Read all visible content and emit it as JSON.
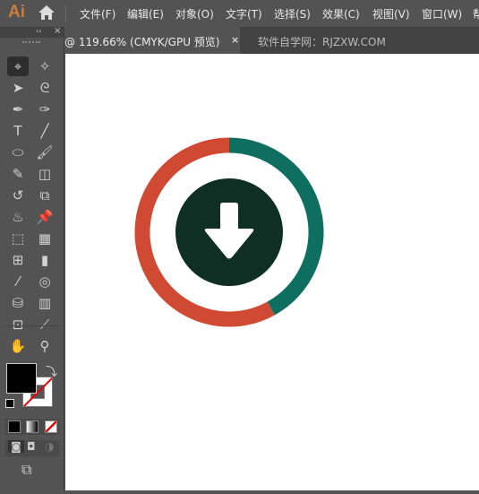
{
  "app": {
    "logo": "Ai"
  },
  "menu": [
    "文件(F)",
    "编辑(E)",
    "对象(O)",
    "文字(T)",
    "选择(S)",
    "效果(C)",
    "视图(V)",
    "窗口(W)",
    "帮"
  ],
  "tabs": {
    "active": "@ 119.66% (CMYK/GPU 预览)",
    "close": "×",
    "other": "软件自学网：RJZXW.COM"
  },
  "panel": {
    "collapse": "‹‹",
    "close": "×"
  },
  "tools": [
    {
      "name": "selection",
      "glyph": "⌖"
    },
    {
      "name": "magic-wand",
      "glyph": "✧"
    },
    {
      "name": "direct-selection",
      "glyph": "➤"
    },
    {
      "name": "lasso",
      "glyph": "ᘓ"
    },
    {
      "name": "pen",
      "glyph": "✒"
    },
    {
      "name": "curvature",
      "glyph": "✑"
    },
    {
      "name": "type",
      "glyph": "T"
    },
    {
      "name": "line",
      "glyph": "╱"
    },
    {
      "name": "ellipse",
      "glyph": "⬭"
    },
    {
      "name": "paintbrush",
      "glyph": "🖌"
    },
    {
      "name": "shaper",
      "glyph": "✎"
    },
    {
      "name": "eraser",
      "glyph": "◫"
    },
    {
      "name": "rotate",
      "glyph": "↺"
    },
    {
      "name": "scale",
      "glyph": "⧉"
    },
    {
      "name": "warp",
      "glyph": "♨"
    },
    {
      "name": "puppet-warp",
      "glyph": "📌"
    },
    {
      "name": "free-transform",
      "glyph": "⬚"
    },
    {
      "name": "perspective-grid",
      "glyph": "▦"
    },
    {
      "name": "mesh",
      "glyph": "⊞"
    },
    {
      "name": "gradient",
      "glyph": "▮"
    },
    {
      "name": "eyedropper",
      "glyph": "⁄"
    },
    {
      "name": "blend",
      "glyph": "◎"
    },
    {
      "name": "symbol-sprayer",
      "glyph": "⛁"
    },
    {
      "name": "column-graph",
      "glyph": "▥"
    },
    {
      "name": "artboard",
      "glyph": "⊡"
    },
    {
      "name": "slice",
      "glyph": "⟋"
    },
    {
      "name": "hand",
      "glyph": "✋"
    },
    {
      "name": "zoom",
      "glyph": "⚲"
    }
  ],
  "colors": {
    "fill": "#000000",
    "stroke": "none",
    "ring_teal": "#0e6e60",
    "ring_red": "#d04a33",
    "inner": "#0f2e24",
    "canvas": "#ffffff"
  },
  "icon": {
    "name": "download-arrow-icon",
    "teal_fraction": 0.42
  }
}
